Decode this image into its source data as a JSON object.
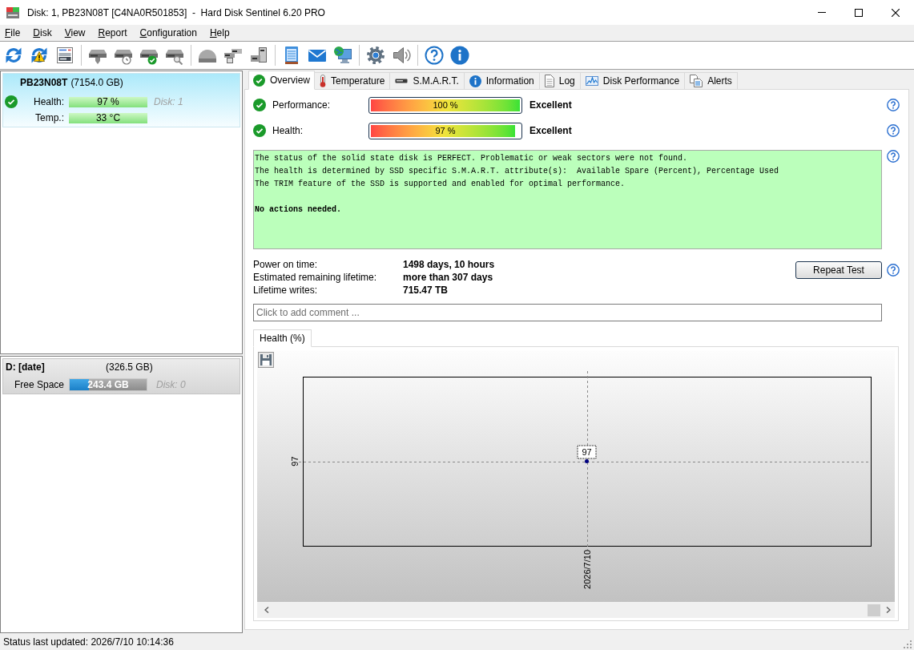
{
  "window": {
    "title": "Disk: 1, PB23N08T [C4NA0R501853]  -  Hard Disk Sentinel 6.20 PRO"
  },
  "menu": [
    {
      "label": "File"
    },
    {
      "label": "Disk"
    },
    {
      "label": "View"
    },
    {
      "label": "Report"
    },
    {
      "label": "Configuration"
    },
    {
      "label": "Help"
    }
  ],
  "disks": [
    {
      "name": "PB23N08T",
      "size": "(7154.0 GB)",
      "selected": true,
      "ok": true,
      "readings": [
        {
          "label": "Health:",
          "value": "97 %",
          "ok": true
        },
        {
          "label": "Temp.:",
          "value": "33 °C",
          "ok": true
        }
      ],
      "disk_label": "Disk: 1"
    }
  ],
  "volumes": [
    {
      "name": "D: [date]",
      "size": "(326.5 GB)",
      "free_label": "Free Space",
      "free_value": "243.4 GB",
      "level": 0.25,
      "disk_label": "Disk: 0"
    }
  ],
  "tabs": [
    {
      "label": "Overview",
      "selected": true
    },
    {
      "label": "Temperature",
      "selected": false
    },
    {
      "label": "S.M.A.R.T.",
      "selected": false
    },
    {
      "label": "Information",
      "selected": false
    },
    {
      "label": "Log",
      "selected": false
    },
    {
      "label": "Disk Performance",
      "selected": false
    },
    {
      "label": "Alerts",
      "selected": false
    }
  ],
  "overview": {
    "ratings": [
      {
        "ok": true,
        "label": "Performance:",
        "value": "100 %",
        "level": 1.0,
        "verdict": "Excellent"
      },
      {
        "ok": true,
        "label": "Health:",
        "value": "97 %",
        "level": 0.97,
        "verdict": "Excellent"
      }
    ],
    "message": {
      "lines": [
        "The status of the solid state disk is PERFECT. Problematic or weak sectors were not found.",
        "The health is determined by SSD specific S.M.A.R.T. attribute(s):  Available Spare (Percent), Percentage Used",
        "The TRIM feature of the SSD is supported and enabled for optimal performance."
      ],
      "conclusion": "No actions needed."
    },
    "details": [
      {
        "label": "Power on time:",
        "value": "1498 days, 10 hours"
      },
      {
        "label": "Estimated remaining lifetime:",
        "value": "more than 307 days"
      },
      {
        "label": "Lifetime writes:",
        "value": "715.47 TB"
      }
    ],
    "repeat_test_button": "Repeat Test",
    "comment": {
      "placeholder": "Click to add comment ..."
    },
    "chart_tabs": [
      {
        "label": "Health (%)",
        "selected": true
      }
    ],
    "health_plot": {
      "y_label": "97",
      "point_label": "97",
      "x_label": "2026/7/10"
    }
  },
  "status_bar": {
    "text": "Status last updated: 2026/7/10 10:14:36"
  }
}
